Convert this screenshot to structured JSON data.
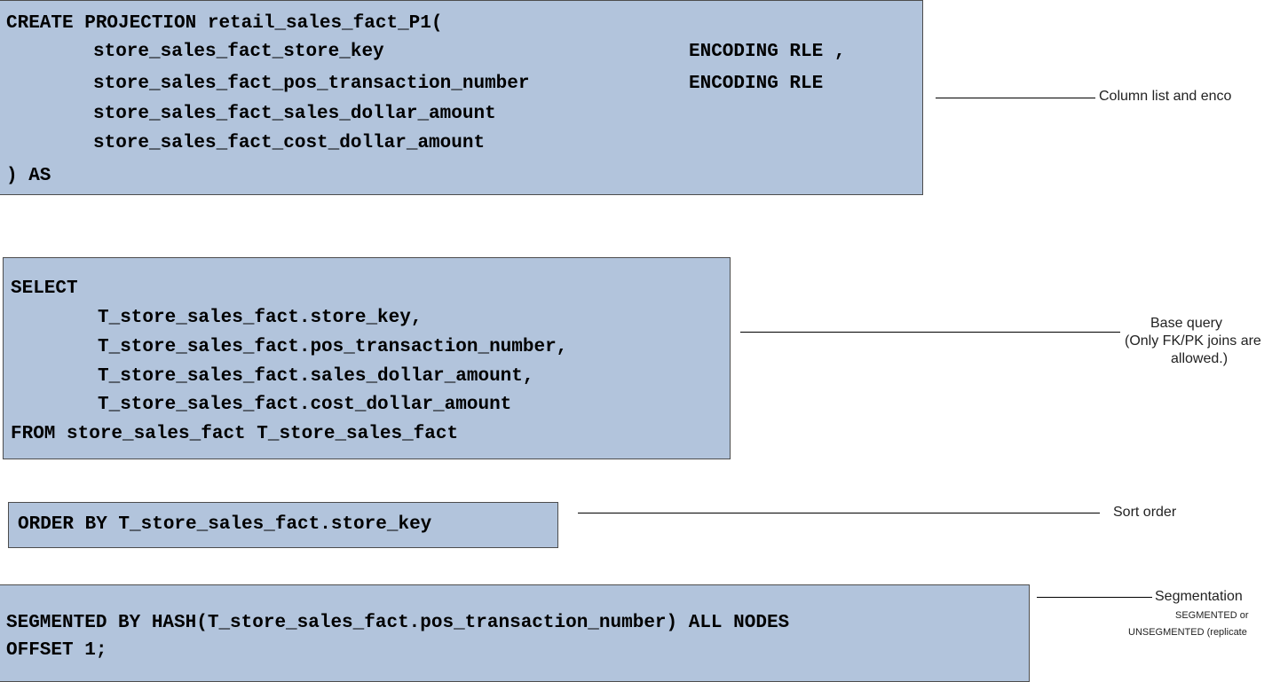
{
  "projection_box": {
    "line1": "CREATE PROJECTION retail_sales_fact_P1(",
    "col1": "store_sales_fact_store_key",
    "col1_enc": "ENCODING RLE ,",
    "col2": "store_sales_fact_pos_transaction_number",
    "col2_enc": "ENCODING RLE",
    "col3": "store_sales_fact_sales_dollar_amount",
    "col4": "store_sales_fact_cost_dollar_amount",
    "closing": ") AS"
  },
  "select_box": {
    "line1": "SELECT",
    "col1": "T_store_sales_fact.store_key,",
    "col2": "T_store_sales_fact.pos_transaction_number,",
    "col3": "T_store_sales_fact.sales_dollar_amount,",
    "col4": "T_store_sales_fact.cost_dollar_amount",
    "from_line": "FROM store_sales_fact T_store_sales_fact"
  },
  "order_box": {
    "line1": "ORDER BY T_store_sales_fact.store_key"
  },
  "segment_box": {
    "line1": "SEGMENTED BY HASH(T_store_sales_fact.pos_transaction_number) ALL NODES",
    "line2": "OFFSET 1;"
  },
  "labels": {
    "column_list": "Column list and enco",
    "base_query": "Base query",
    "base_query_note1": "(Only FK/PK joins are",
    "base_query_note2": "allowed.)",
    "sort_order": "Sort order",
    "segmentation": "Segmentation",
    "segmentation_note1": "SEGMENTED or",
    "segmentation_note2": "UNSEGMENTED (replicate"
  },
  "colors": {
    "box_fill": "#b2c4dc",
    "box_border": "#4d4d4d"
  }
}
